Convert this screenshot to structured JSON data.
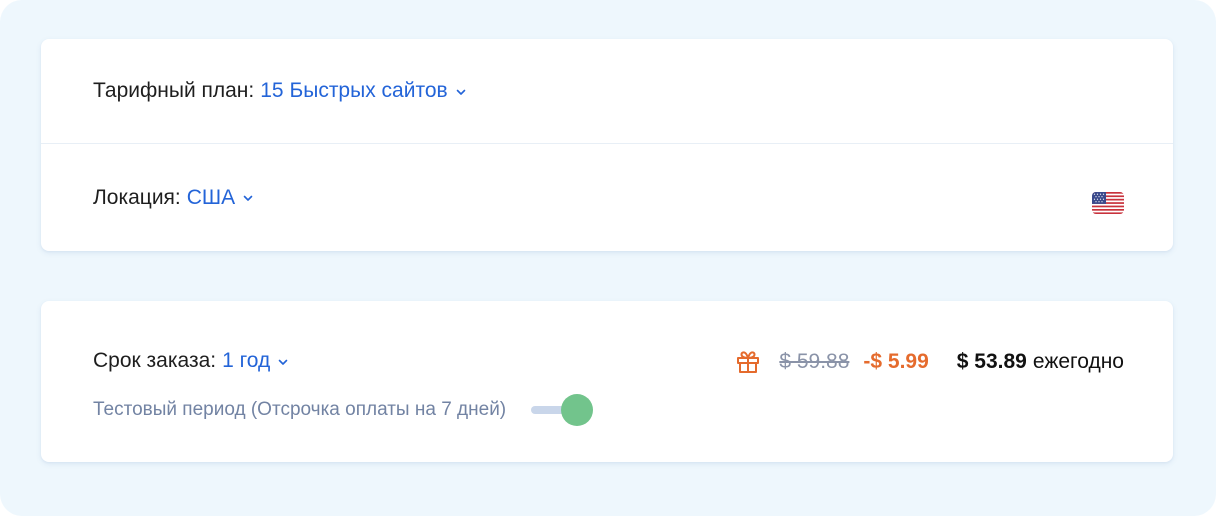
{
  "plan": {
    "label": "Тарифный план:",
    "value": "15 Быстрых сайтов"
  },
  "location": {
    "label": "Локация:",
    "value": "США",
    "flag_icon": "us-flag-icon"
  },
  "order": {
    "term_label": "Срок заказа:",
    "term_value": "1 год",
    "trial_text": "Тестовый период (Отсрочка оплаты на 7 дней)",
    "trial_enabled": true
  },
  "pricing": {
    "gift_icon": "gift-icon",
    "old_price": "$ 59.88",
    "discount": "-$ 5.99",
    "final_price": "$ 53.89",
    "period": "ежегодно"
  },
  "colors": {
    "background": "#eef7fd",
    "accent_blue": "#2364d8",
    "discount_orange": "#e56b2d",
    "toggle_green": "#72c48c",
    "muted_text": "#7283a3"
  }
}
